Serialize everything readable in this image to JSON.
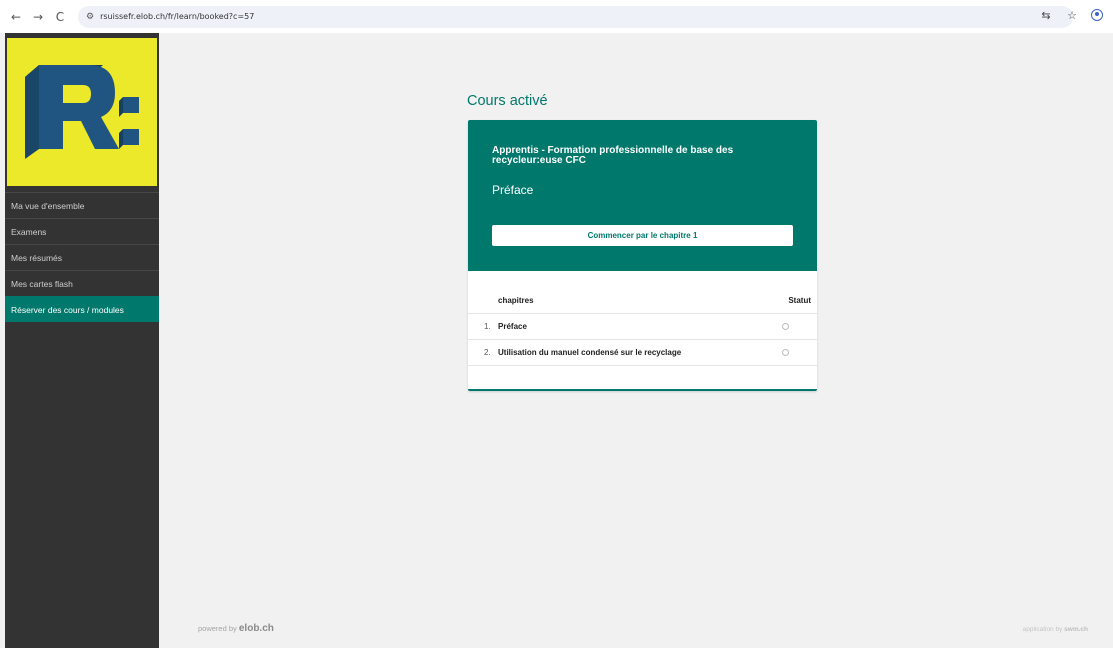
{
  "browser": {
    "back": "←",
    "forward": "→",
    "reload": "C",
    "url": "rsuissefr.elob.ch/fr/learn/booked?c=57",
    "translate": "⇆",
    "bookmark": "☆"
  },
  "sidebar": {
    "items": [
      {
        "label": "Ma vue d'ensemble",
        "active": false
      },
      {
        "label": "Examens",
        "active": false
      },
      {
        "label": "Mes résumés",
        "active": false
      },
      {
        "label": "Mes cartes flash",
        "active": false
      },
      {
        "label": "Réserver des cours / modules",
        "active": true
      }
    ]
  },
  "main": {
    "title": "Cours activé",
    "course": {
      "title": "Apprentis - Formation professionnelle de base des recycleur:euse CFC",
      "subtitle": "Préface",
      "start_button": "Commencer par le chapitre 1"
    },
    "table": {
      "col_chapters": "chapitres",
      "col_status": "Statut",
      "rows": [
        {
          "num": "1.",
          "name": "Préface"
        },
        {
          "num": "2.",
          "name": "Utilisation du manuel condensé sur le recyclage"
        }
      ]
    }
  },
  "footer": {
    "powered_prefix": "powered by",
    "powered_brand": "elob.ch",
    "app_prefix": "application by",
    "app_brand": "swm.ch"
  },
  "colors": {
    "accent": "#00786b",
    "sidebar": "#333333",
    "logo_bg": "#ece82a",
    "logo_blue": "#1f5580"
  }
}
